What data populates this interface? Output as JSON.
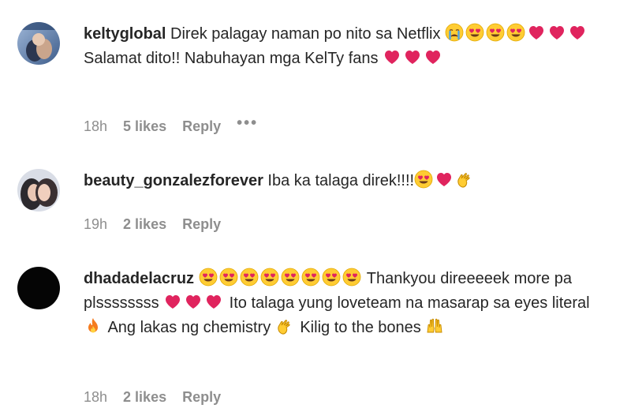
{
  "comments": [
    {
      "username": "keltyglobal",
      "segments": [
        {
          "t": "text",
          "v": "Direk palagay naman po nito sa Netflix "
        },
        {
          "t": "emoji",
          "v": "crying-face"
        },
        {
          "t": "emoji",
          "v": "heart-eyes"
        },
        {
          "t": "emoji",
          "v": "heart-eyes"
        },
        {
          "t": "emoji",
          "v": "heart-eyes"
        },
        {
          "t": "emoji",
          "v": "red-heart"
        },
        {
          "t": "emoji",
          "v": "red-heart"
        },
        {
          "t": "emoji",
          "v": "red-heart"
        },
        {
          "t": "text",
          "v": " Salamat dito!! Nabuhayan mga KelTy fans "
        },
        {
          "t": "emoji",
          "v": "red-heart"
        },
        {
          "t": "emoji",
          "v": "red-heart"
        },
        {
          "t": "emoji",
          "v": "red-heart"
        }
      ],
      "time": "18h",
      "likes": "5 likes",
      "reply": "Reply",
      "more": "•••"
    },
    {
      "username": "beauty_gonzalezforever",
      "segments": [
        {
          "t": "text",
          "v": "Iba ka talaga direk!!!!"
        },
        {
          "t": "emoji",
          "v": "heart-eyes"
        },
        {
          "t": "emoji",
          "v": "red-heart"
        },
        {
          "t": "emoji",
          "v": "clapping-hands"
        }
      ],
      "time": "19h",
      "likes": "2 likes",
      "reply": "Reply"
    },
    {
      "username": "dhadadelacruz",
      "segments": [
        {
          "t": "emoji",
          "v": "heart-eyes"
        },
        {
          "t": "emoji",
          "v": "heart-eyes"
        },
        {
          "t": "emoji",
          "v": "heart-eyes"
        },
        {
          "t": "emoji",
          "v": "heart-eyes"
        },
        {
          "t": "emoji",
          "v": "heart-eyes"
        },
        {
          "t": "emoji",
          "v": "heart-eyes"
        },
        {
          "t": "emoji",
          "v": "heart-eyes"
        },
        {
          "t": "emoji",
          "v": "heart-eyes"
        },
        {
          "t": "text",
          "v": " Thankyou direeeeek more pa plssssssss "
        },
        {
          "t": "emoji",
          "v": "red-heart"
        },
        {
          "t": "emoji",
          "v": "red-heart"
        },
        {
          "t": "emoji",
          "v": "red-heart"
        },
        {
          "t": "text",
          "v": " Ito talaga yung loveteam na masarap sa eyes literal "
        },
        {
          "t": "emoji",
          "v": "fire"
        },
        {
          "t": "text",
          "v": " Ang lakas ng chemistry "
        },
        {
          "t": "emoji",
          "v": "clapping-hands"
        },
        {
          "t": "text",
          "v": " Kilig to the bones "
        },
        {
          "t": "emoji",
          "v": "raising-hands"
        }
      ],
      "time": "18h",
      "likes": "2 likes",
      "reply": "Reply"
    }
  ],
  "colors": {
    "text": "#262626",
    "meta": "#8e8e8e",
    "heart": "#e0245e",
    "emoji_yellow": "#ffcc33"
  }
}
